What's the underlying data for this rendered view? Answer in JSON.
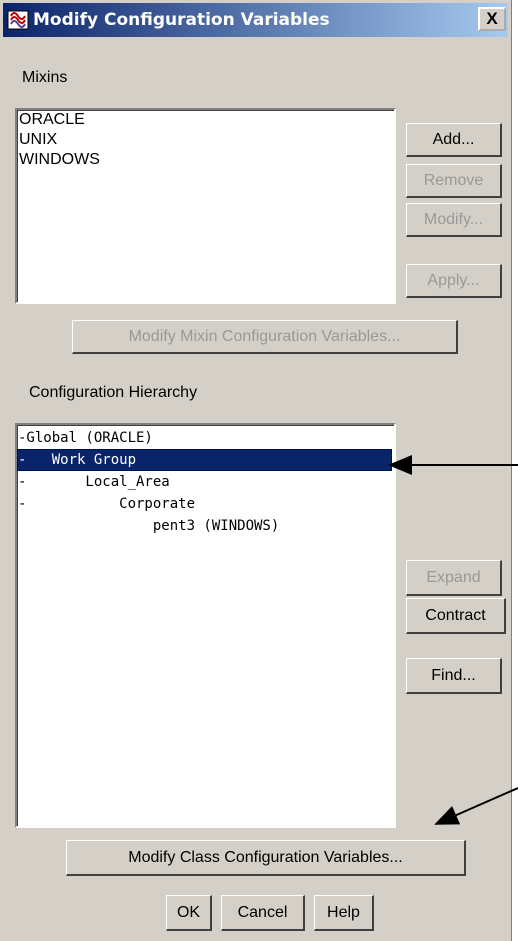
{
  "window": {
    "title": "Modify Configuration Variables",
    "close_label": "X"
  },
  "mixins": {
    "section_label": "Mixins",
    "items": [
      "ORACLE",
      "UNIX",
      "WINDOWS"
    ],
    "buttons": {
      "add": "Add...",
      "remove": "Remove",
      "modify": "Modify...",
      "apply": "Apply..."
    },
    "modify_vars_button": "Modify Mixin Configuration Variables..."
  },
  "hierarchy": {
    "section_label": "Configuration Hierarchy",
    "items": [
      {
        "text": "-Global (ORACLE)",
        "selected": false
      },
      {
        "text": "-   Work Group",
        "selected": true
      },
      {
        "text": "-       Local_Area",
        "selected": false
      },
      {
        "text": "-           Corporate",
        "selected": false
      },
      {
        "text": "                pent3 (WINDOWS)",
        "selected": false
      }
    ],
    "buttons": {
      "expand": "Expand",
      "contract": "Contract",
      "find": "Find..."
    },
    "modify_class_button": "Modify Class Configuration Variables..."
  },
  "footer": {
    "ok": "OK",
    "cancel": "Cancel",
    "help": "Help"
  },
  "colors": {
    "dialog_bg": "#d4d0c8",
    "selection": "#0a246a",
    "title_start": "#0a246a",
    "title_end": "#a6caf0"
  }
}
